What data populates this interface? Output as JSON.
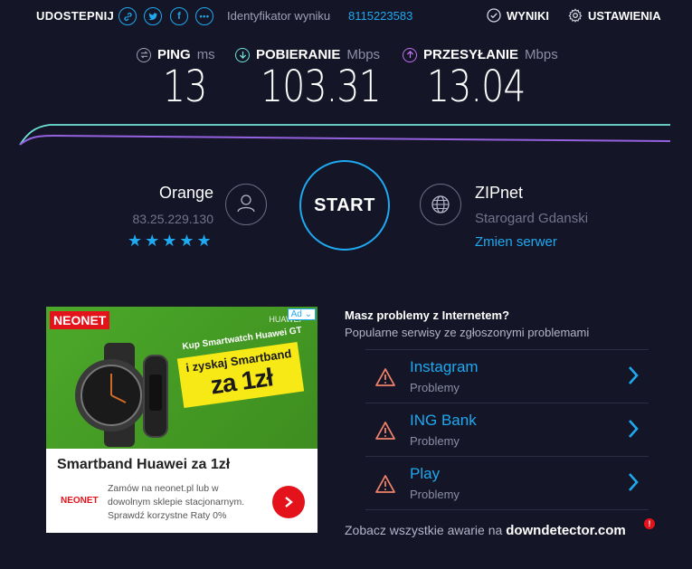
{
  "header": {
    "share_label": "UDOSTEPNIJ",
    "share_icons": [
      "link-icon",
      "twitter-icon",
      "facebook-icon",
      "more-icon"
    ],
    "result_id_label": "Identyfikator wyniku",
    "result_id": "8115223583",
    "nav": [
      {
        "label": "WYNIKI",
        "icon": "check-circle-icon"
      },
      {
        "label": "USTAWIENIA",
        "icon": "gear-icon"
      }
    ]
  },
  "metrics": {
    "ping": {
      "label": "PING",
      "unit": "ms",
      "value": "13",
      "color": "#9fa0b5"
    },
    "download": {
      "label": "POBIERANIE",
      "unit": "Mbps",
      "value": "103.31",
      "color": "#6ee3d8"
    },
    "upload": {
      "label": "PRZESYŁANIE",
      "unit": "Mbps",
      "value": "13.04",
      "color": "#bf71f2"
    }
  },
  "isp": {
    "name": "Orange",
    "ip": "83.25.229.130",
    "rating": 5,
    "stars": "★★★★★"
  },
  "start_button": {
    "label": "START"
  },
  "server": {
    "name": "ZIPnet",
    "location": "Starogard Gdanski",
    "change_label": "Zmien serwer"
  },
  "ad": {
    "badge": "Ad",
    "logo": "NEONET",
    "brand": "HUAWEI",
    "promo_small": "Kup Smartwatch Huawei GT",
    "promo_line1": "i zyskaj Smartband",
    "promo_line2": "za 1zł",
    "title": "Smartband Huawei za 1zł",
    "description": "Zamów na neonet.pl lub w dowolnym sklepie stacjonarnym. Sprawdź korzystne Raty 0%",
    "logo_small": "NEONET"
  },
  "outages": {
    "title": "Masz problemy z Internetem?",
    "subtitle": "Popularne serwisy ze zgłoszonymi problemami",
    "items": [
      {
        "name": "Instagram",
        "status": "Problemy"
      },
      {
        "name": "ING Bank",
        "status": "Problemy"
      },
      {
        "name": "Play",
        "status": "Problemy"
      }
    ],
    "footer_text": "Zobacz wszystkie awarie na",
    "footer_brand": "downdetector.com",
    "footer_badge": "!"
  },
  "colors": {
    "background": "#141526",
    "accent": "#1fa9f0",
    "warning": "#f0826a",
    "ad_red": "#e3121b"
  }
}
